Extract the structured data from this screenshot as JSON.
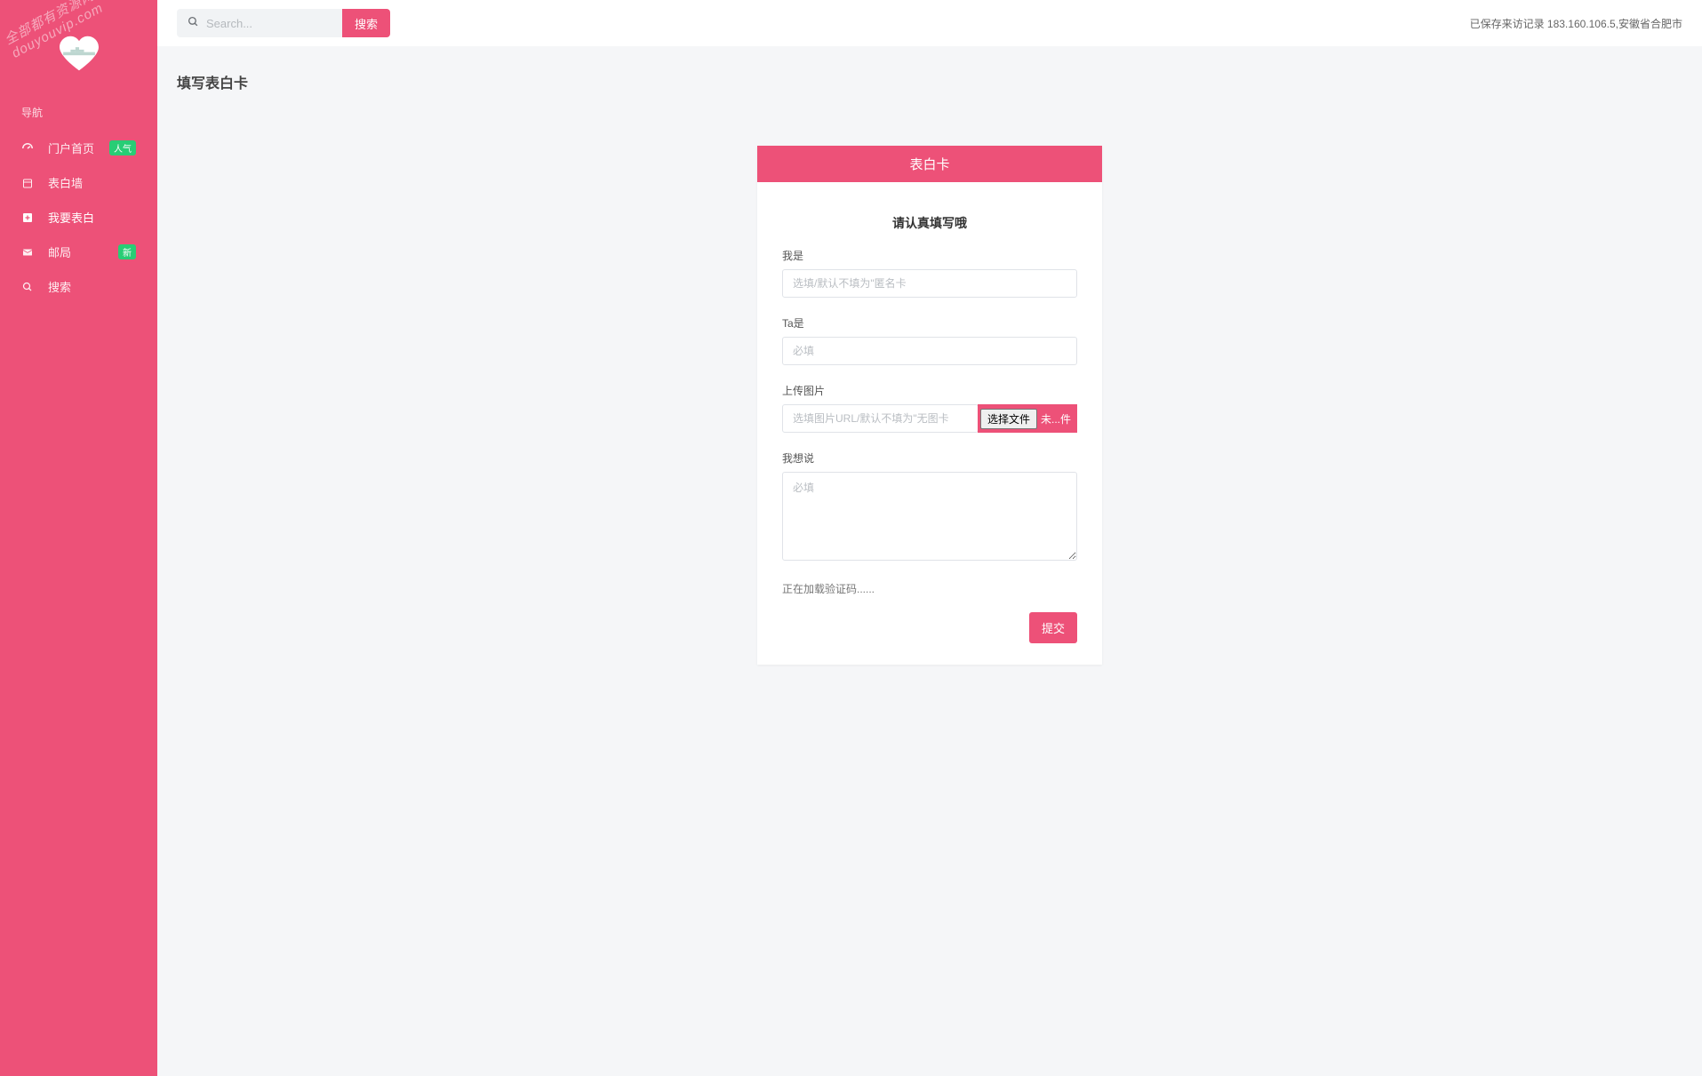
{
  "watermark": {
    "line1": "全部都有资源网",
    "line2": "douyouvip.com"
  },
  "nav": {
    "header": "导航",
    "items": [
      {
        "label": "门户首页",
        "badge": "人气"
      },
      {
        "label": "表白墙",
        "badge": null
      },
      {
        "label": "我要表白",
        "badge": null
      },
      {
        "label": "邮局",
        "badge": "新"
      },
      {
        "label": "搜索",
        "badge": null
      }
    ]
  },
  "topbar": {
    "search_placeholder": "Search...",
    "search_button": "搜索",
    "status": "已保存来访记录 183.160.106.5,安徽省合肥市"
  },
  "page": {
    "title": "填写表白卡"
  },
  "card": {
    "header": "表白卡",
    "form_title": "请认真填写哦",
    "fields": {
      "who_am_i": {
        "label": "我是",
        "placeholder": "选填/默认不填为\"匿名卡"
      },
      "who_is_ta": {
        "label": "Ta是",
        "placeholder": "必填"
      },
      "upload": {
        "label": "上传图片",
        "placeholder": "选填图片URL/默认不填为\"无图卡",
        "choose_btn": "选择文件",
        "status": "未...件"
      },
      "message": {
        "label": "我想说",
        "placeholder": "必填"
      }
    },
    "captcha_loading": "正在加载验证码......",
    "submit": "提交"
  }
}
